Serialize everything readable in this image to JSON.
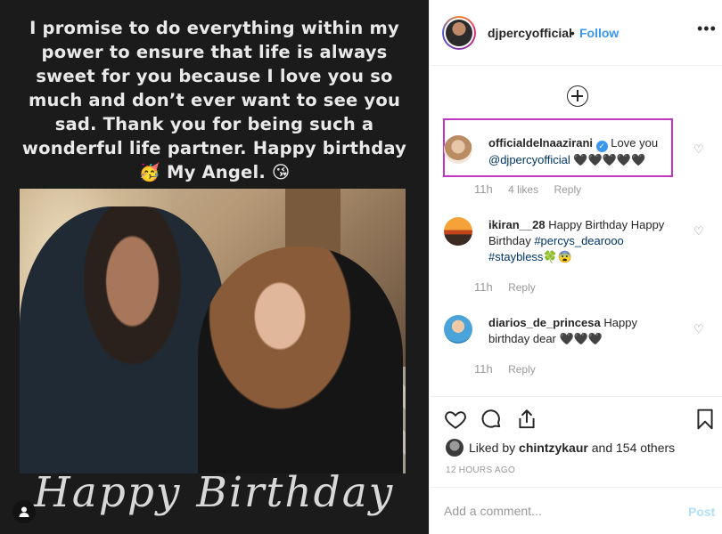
{
  "image": {
    "caption_overlay": "I promise to do everything within my power to ensure that life is always sweet for you because I love you so much and don’t ever want to see you sad. Thank you for being such a wonderful life partner. Happy birthday 🥳 My Angel. 😘",
    "bottom_text": "Happy Birthday"
  },
  "header": {
    "username": "djpercyofficial",
    "separator": "•",
    "follow_label": "Follow",
    "more_label": "•••"
  },
  "comments": [
    {
      "username": "officialdelnaazirani",
      "text": "Love you",
      "mention": "@djpercyofficial",
      "suffix": "🖤🖤🖤🖤🖤",
      "time": "11h",
      "likes": "4 likes",
      "reply": "Reply"
    },
    {
      "username": "ikiran__28",
      "text": "Happy Birthday Happy Birthday",
      "hashtag1": "#percys_dearooo",
      "hashtag2": "#staybless",
      "suffix": "🍀😨",
      "time": "11h",
      "reply": "Reply"
    },
    {
      "username": "diarios_de_princesa",
      "text": "Happy birthday dear 🖤🖤🖤",
      "time": "11h",
      "reply": "Reply"
    }
  ],
  "likes": {
    "prefix": "Liked by",
    "user": "chintzykaur",
    "suffix": "and 154 others"
  },
  "timestamp": "12 HOURS AGO",
  "comment_box": {
    "placeholder": "Add a comment...",
    "post_label": "Post"
  }
}
